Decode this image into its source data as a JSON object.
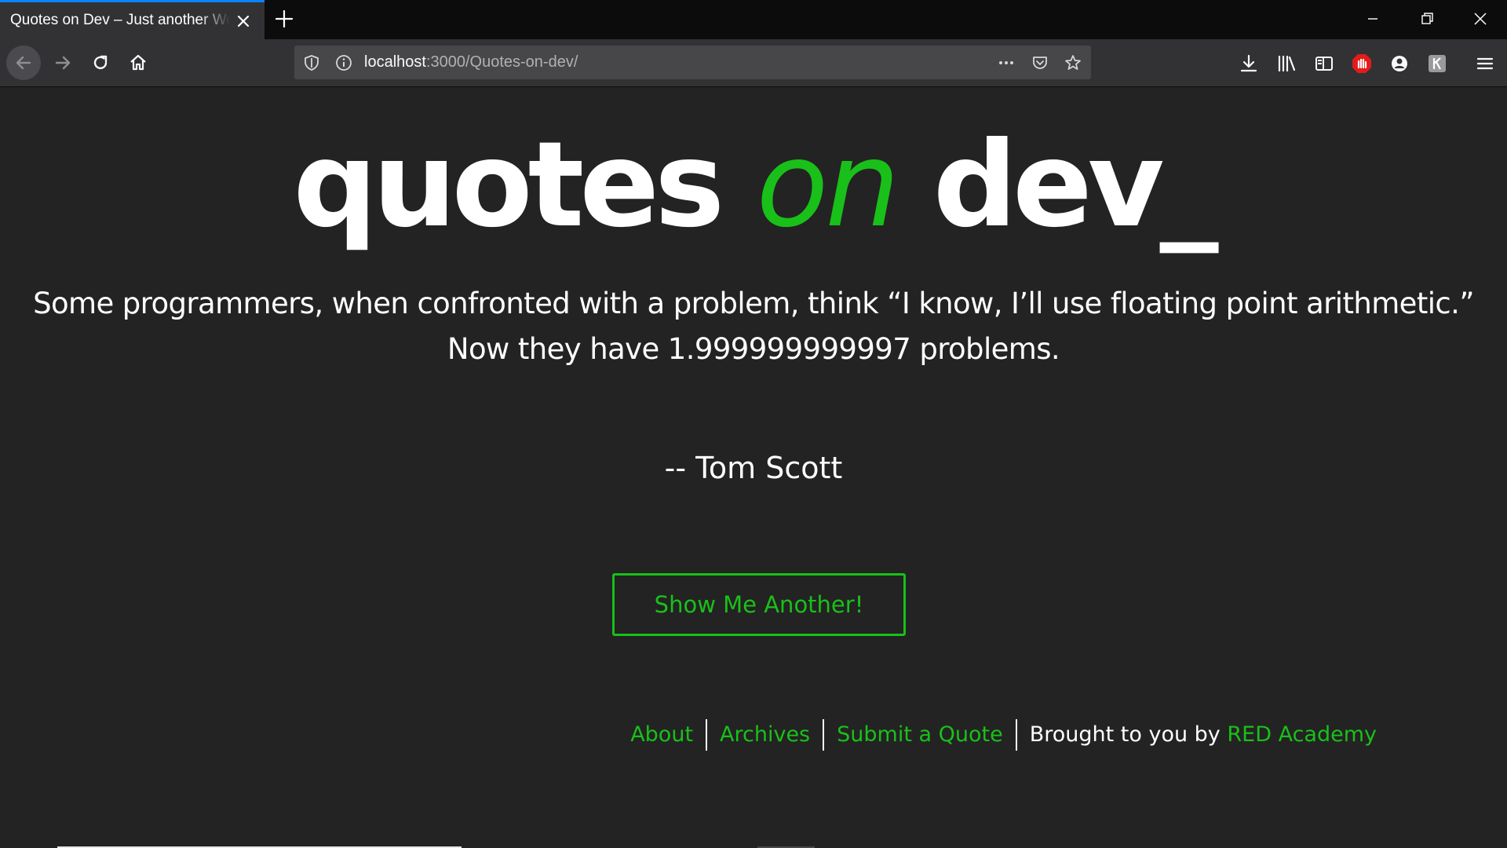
{
  "browser": {
    "tab_title": "Quotes on Dev – Just another WordPress site",
    "url_host": "localhost",
    "url_rest": ":3000/Quotes-on-dev/"
  },
  "site": {
    "logo_word1": "quotes",
    "logo_word2": "on",
    "logo_word3": "dev_"
  },
  "quote": {
    "text": "Some programmers, when confronted with a problem, think “I know, I’ll use floating point arithmetic.” Now they have 1.999999999997 problems.",
    "author": "-- Tom Scott"
  },
  "button": {
    "label": "Show Me Another!"
  },
  "footer": {
    "links": [
      "About",
      "Archives",
      "Submit a Quote"
    ],
    "credit_prefix": "Brought to you by",
    "credit_link": "RED Academy"
  },
  "colors": {
    "accent": "#19c019",
    "background": "#232323",
    "text": "#ffffff"
  }
}
